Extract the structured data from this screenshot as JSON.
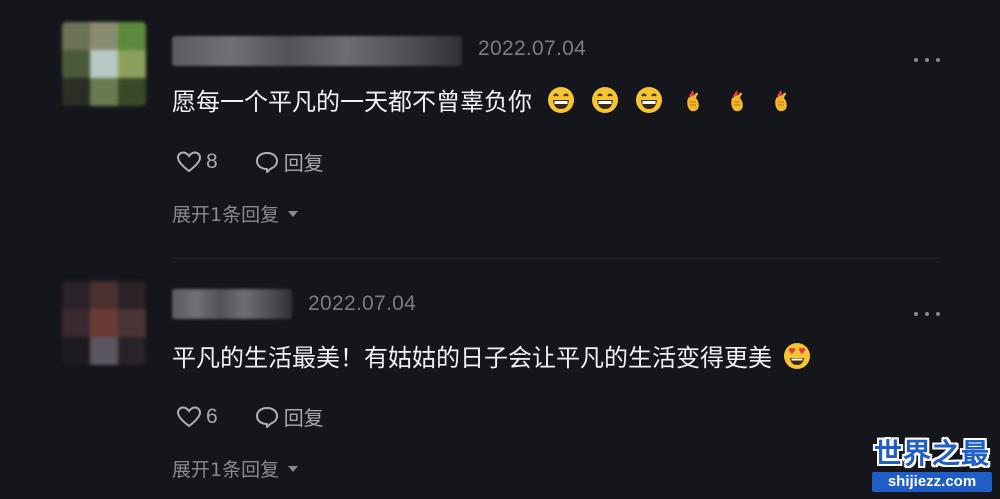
{
  "comments": [
    {
      "date": "2022.07.04",
      "text": "愿每一个平凡的一天都不曾辜负你",
      "emojis": [
        "grinning-face-icon",
        "grinning-face-icon",
        "grinning-face-icon",
        "hand-with-index-finger-and-thumb-crossed-icon",
        "hand-with-index-finger-and-thumb-crossed-icon",
        "hand-with-index-finger-and-thumb-crossed-icon"
      ],
      "likes": "8",
      "reply_label": "回复",
      "expand_label": "展开1条回复"
    },
    {
      "date": "2022.07.04",
      "text": "平凡的生活最美！有姑姑的日子会让平凡的生活变得更美",
      "emojis": [
        "smiling-face-with-heart-eyes-icon"
      ],
      "likes": "6",
      "reply_label": "回复",
      "expand_label": "展开1条回复"
    }
  ],
  "watermark": {
    "title": "世界之最",
    "url": "shijiezz.com"
  },
  "colors": {
    "background": "#15151c",
    "text_primary": "#f2f2f4",
    "text_secondary": "#a8a8b0",
    "date": "#7c7c86",
    "watermark_blue": "#1f5ec8"
  }
}
